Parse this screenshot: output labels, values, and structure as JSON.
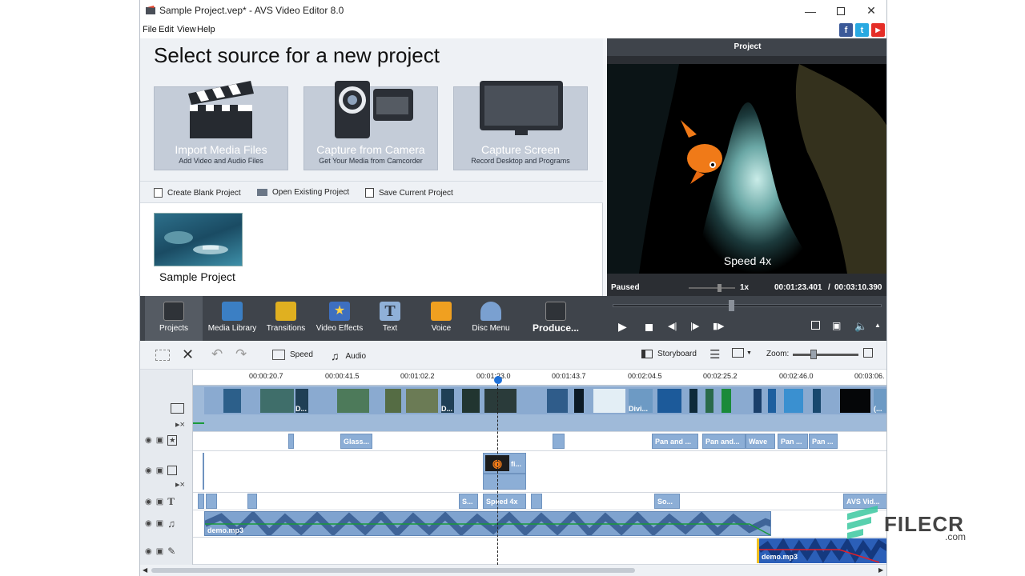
{
  "window": {
    "title": "Sample Project.vep* - AVS Video Editor 8.0"
  },
  "menu": {
    "items": [
      "File",
      "Edit",
      "View",
      "Help"
    ]
  },
  "social": [
    "f",
    "t",
    "▶"
  ],
  "source": {
    "heading": "Select source for a new project",
    "cards": [
      {
        "title": "Import Media Files",
        "subtitle": "Add Video and Audio Files"
      },
      {
        "title": "Capture from Camera",
        "subtitle": "Get Your Media from Camcorder"
      },
      {
        "title": "Capture Screen",
        "subtitle": "Record Desktop and Programs"
      }
    ],
    "actions": [
      "Create Blank Project",
      "Open Existing Project",
      "Save Current Project"
    ],
    "recent": {
      "label": "Sample Project"
    }
  },
  "preview": {
    "header": "Project",
    "overlay": "Speed 4x",
    "status": "Paused",
    "speed": "1x",
    "current_time": "00:01:23.401",
    "separator": "/",
    "total_time": "00:03:10.390"
  },
  "toolbar": {
    "tools": [
      {
        "label": "Projects",
        "icon": "clapperboard-icon",
        "color": "#2f3338"
      },
      {
        "label": "Media Library",
        "icon": "film-strip-icon",
        "color": "#3b7fc4"
      },
      {
        "label": "Transitions",
        "icon": "transitions-icon",
        "color": "#e0b020"
      },
      {
        "label": "Video Effects",
        "icon": "star-effect-icon",
        "color": "#3d6fc0"
      },
      {
        "label": "Text",
        "icon": "text-t-icon",
        "color": "#8fb0d8"
      },
      {
        "label": "Voice",
        "icon": "microphone-icon",
        "color": "#f0a020"
      },
      {
        "label": "Disc Menu",
        "icon": "disc-menu-icon",
        "color": "#7aa0d0"
      },
      {
        "label": "Produce...",
        "icon": "produce-icon",
        "color": "#2f3338"
      }
    ]
  },
  "timeline_toolbar": {
    "speed": "Speed",
    "audio": "Audio",
    "storyboard": "Storyboard",
    "zoom": "Zoom:"
  },
  "ruler": {
    "ticks": [
      "00:00:20.7",
      "00:00:41.5",
      "00:01:02.2",
      "00:01:23.0",
      "00:01:43.7",
      "00:02:04.5",
      "00:02:25.2",
      "00:02:46.0",
      "00:03:06."
    ]
  },
  "tracks": {
    "video_clip_labels": [
      "D...",
      "D...",
      "Divi...",
      "(..."
    ],
    "effects": [
      "Glass...",
      "Pan and ...",
      "Pan and...",
      "Wave",
      "Pan ...",
      "Pan ..."
    ],
    "overlay": [
      "fi..."
    ],
    "text": [
      "S...",
      "Speed 4x",
      "So...",
      "AVS Vid..."
    ],
    "music": [
      "demo.mp3"
    ],
    "voice": [
      "demo.mp3"
    ]
  },
  "watermark": {
    "brand": "FILECR",
    "suffix": ".com"
  }
}
